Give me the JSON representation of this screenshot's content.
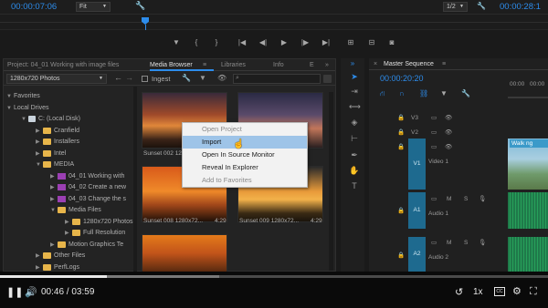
{
  "source_monitor": {
    "timecode": "00:00:07:06",
    "zoom": "Fit"
  },
  "program_monitor": {
    "scale": "1/2",
    "timecode": "00:00:28:1"
  },
  "project": {
    "title": "Project: 04_01 Working with image files",
    "dropdown": "1280x720 Photos",
    "tabs": [
      "Media Browser",
      "Libraries",
      "Info",
      "E"
    ]
  },
  "media_browser": {
    "ingest_label": "Ingest",
    "search_icon": "search-icon"
  },
  "tree": [
    {
      "label": "Favorites",
      "kind": "section"
    },
    {
      "label": "Local Drives",
      "kind": "section"
    },
    {
      "label": "C: (Local Disk)",
      "kind": "drive"
    },
    {
      "label": "Cranfield",
      "kind": "folder"
    },
    {
      "label": "Installers",
      "kind": "folder"
    },
    {
      "label": "Intel",
      "kind": "folder"
    },
    {
      "label": "MEDIA",
      "kind": "folder"
    },
    {
      "label": "04_01 Working with",
      "kind": "project"
    },
    {
      "label": "04_02 Create a new",
      "kind": "project"
    },
    {
      "label": "04_03 Change the s",
      "kind": "project"
    },
    {
      "label": "Media Files",
      "kind": "folder"
    },
    {
      "label": "1280x720 Photos",
      "kind": "folder"
    },
    {
      "label": "Full Resolution",
      "kind": "folder"
    },
    {
      "label": "Motion Graphics Te",
      "kind": "folder"
    },
    {
      "label": "Other Files",
      "kind": "folder"
    },
    {
      "label": "PerfLogs",
      "kind": "folder"
    }
  ],
  "thumbs": [
    {
      "caption": "Sunset 002 1280x72",
      "duration": ""
    },
    {
      "caption": "",
      "duration": ""
    },
    {
      "caption": "Sunset 008 1280x72...",
      "duration": "4:29"
    },
    {
      "caption": "Sunset 009 1280x72...",
      "duration": "4:29"
    },
    {
      "caption": "",
      "duration": ""
    }
  ],
  "context_menu": {
    "items": [
      "Open Project",
      "Import",
      "Open In Source Monitor",
      "Reveal In Explorer",
      "Add to Favorites"
    ]
  },
  "sequence": {
    "title": "Master Sequence",
    "timecode": "00:00:20:20",
    "ruler": [
      "00:00",
      "00:00"
    ],
    "clip_label": "Walk ng"
  },
  "tracks": [
    {
      "name": "V3"
    },
    {
      "name": "V2"
    },
    {
      "name": "V1",
      "label": "Video 1"
    },
    {
      "name": "A1",
      "label": "Audio 1"
    },
    {
      "name": "A2",
      "label": "Audio 2"
    }
  ],
  "track_buttons": {
    "m": "M",
    "s": "S"
  },
  "player": {
    "time": "00:46 / 03:59",
    "speed": "1x",
    "progress": 0.195
  }
}
